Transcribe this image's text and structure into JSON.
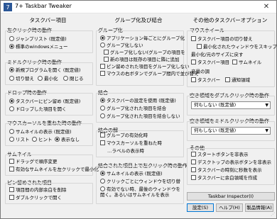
{
  "window": {
    "title": "7+ Taskbar Tweaker",
    "close_glyph": "✕"
  },
  "col1": {
    "header": "タスクバー項目",
    "left_click": {
      "title": "左クリック時の動作",
      "opt1": "ジャンプリスト (既定値)",
      "opt2": "標準のwindowsメニュー"
    },
    "middle_click": {
      "title": "ミドルクリック時の動作",
      "opt1": "新規プログラムを開く (既定値)",
      "opt2": "切り替え",
      "opt3": "最小化",
      "opt4": "閉じる"
    },
    "drop": {
      "title": "ドロップ時の動作",
      "opt1": "タスクバーにピン留め (既定値)",
      "opt2": "ドロップした項目を開く"
    },
    "hover": {
      "title": "マウスカーソルを重ねた時の動作",
      "opt1": "サムネイルの表示 (既定値)",
      "opt2": "リスト",
      "opt3": "ヒント",
      "opt4": "表示なし"
    },
    "thumbnail": {
      "title": "サムネイル",
      "chk1": "ドラッグで順序変更",
      "chk2": "有効なサムネイルを左クリックで最小化"
    },
    "pinned": {
      "title": "ピン留めされた項目",
      "chk1": "項目間の内部余白を削除",
      "chk2": "ダブルクリックで開く"
    }
  },
  "col2": {
    "header": "グループ化及び結合",
    "grouping": {
      "title": "グループ化",
      "opt1": "アプリケーション毎ごとにグループ化",
      "opt2": "グループ化しない",
      "chk1": "グループ化しない(グループの項目を",
      "chk2": "新の項目は既存の項目に隣に追加",
      "chk3": "ピン留めされた項目をグループ化しない",
      "chk4": "マウスの右ボタンでグループ間内で並び替え"
    },
    "combining": {
      "title": "結合",
      "opt1": "タスクバーの設定を使用 (既定値)",
      "opt2": "グループ化された項目を結合",
      "opt3": "グループ化された項目を結合しない"
    },
    "combined_items": {
      "title": "結合の解",
      "chk1": "グループの有効化時",
      "chk2": "マウスカーソルを重ねた時",
      "chk3": "…ラベルの表示時"
    },
    "combined_left": {
      "title": "結合された項目上で左クリック時の動作",
      "opt1": "サムネイルの表示 (既定値)",
      "opt2": "クリックごとにウィンドウを切り替",
      "opt3": "有効でない時、最後のウィンドウを開く。あるいはサムネイルを表示"
    }
  },
  "col3": {
    "header": "その他のタスクバーオプション",
    "mouse_wheel": {
      "title": "マウスホイール",
      "chk1": "タスクバー項目の切り替え",
      "chk2": "最小化されたウィンドウをスキップ",
      "sub": "最小化/元のサイズに戻す",
      "chk3": "タスクバー項目",
      "chk4": "サムネイル",
      "sub2": "音量の調",
      "chk5": "タスクバー",
      "chk6": "通知領域"
    },
    "empty_dbl": {
      "title": "空き領域をダブルクリック時の動作",
      "value": "何もしない (既定値)"
    },
    "empty_mid": {
      "title": "空き領域をミドルクリック時の動作",
      "value": "何もしない (既定値)"
    },
    "other": {
      "title": "その他",
      "chk1": "スタートボタンを非表示",
      "chk2": "デスクトップの表示ボタンを非表示",
      "chk3": "タスクバーの時刻に秒数を表示",
      "chk4": "タスクバーに余白領域を作成"
    },
    "inspector_button": "Taskbar Inspector(I)",
    "settings_button": "設定(S)",
    "help_button": "ヘルプ(H)",
    "about_button": "製品情報(A)"
  }
}
